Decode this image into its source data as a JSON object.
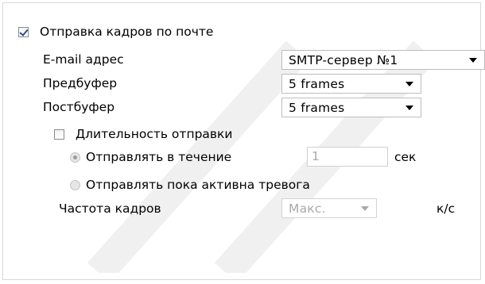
{
  "email_section": {
    "checkbox_label": "Отправка кадров по почте",
    "checked": true
  },
  "email_address": {
    "label": "E-mail адрес",
    "value": "SMTP-сервер №1"
  },
  "prebuffer": {
    "label": "Предбуфер",
    "value": "5  frames"
  },
  "postbuffer": {
    "label": "Постбуфер",
    "value": "5  frames"
  },
  "duration": {
    "checkbox_label": "Длительность отправки",
    "checked": false
  },
  "send_during": {
    "label": "Отправлять в течение",
    "value": "1",
    "unit": "сек",
    "selected": true
  },
  "send_while_alarm": {
    "label": "Отправлять пока активна тревога",
    "selected": false
  },
  "frame_rate": {
    "label": "Частота кадров",
    "value": "Макс.",
    "unit": "к/с"
  }
}
